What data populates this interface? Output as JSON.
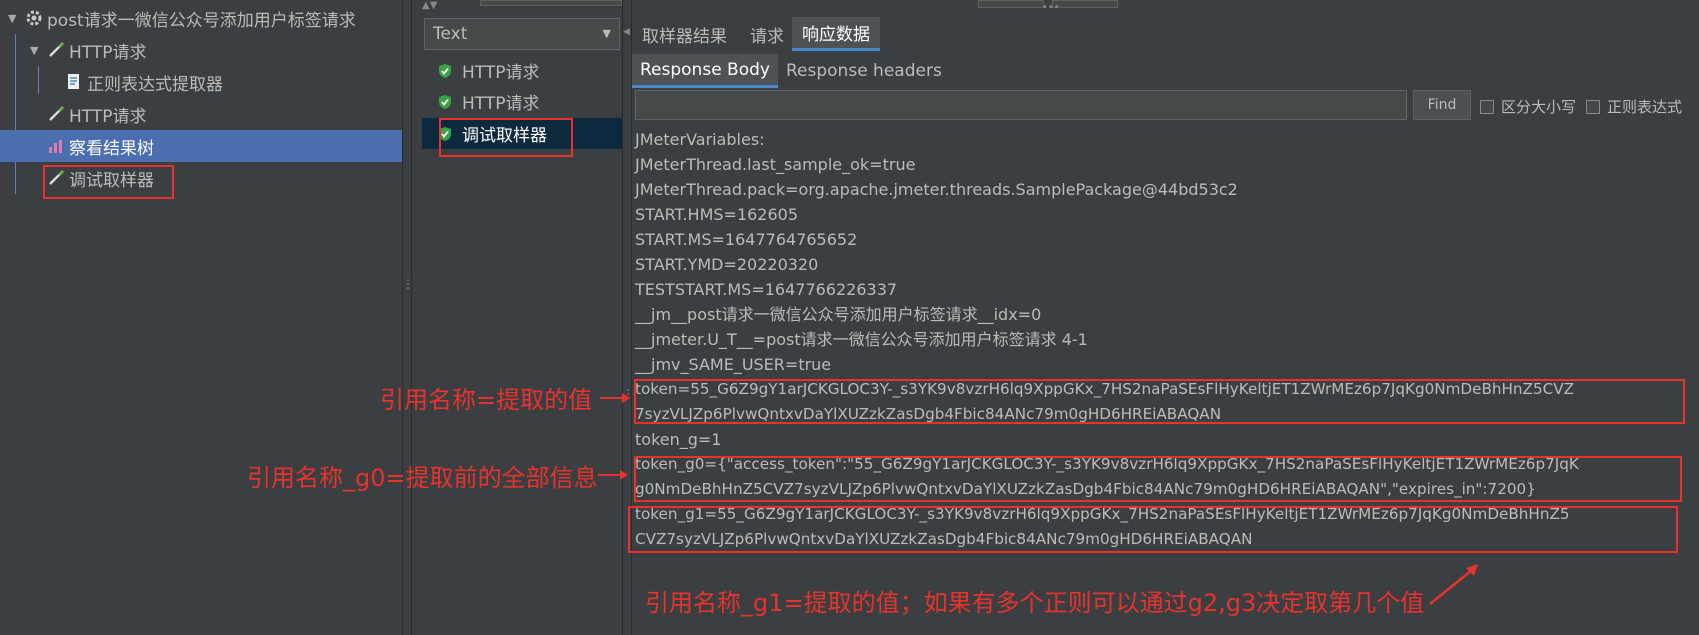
{
  "tree": {
    "root": "post请求一微信公众号添加用户标签请求",
    "items": [
      {
        "label": "HTTP请求"
      },
      {
        "label": "正则表达式提取器"
      },
      {
        "label": "HTTP请求"
      },
      {
        "label": "察看结果树"
      },
      {
        "label": "调试取样器"
      }
    ]
  },
  "results": {
    "renderer": "Text",
    "items": [
      {
        "label": "HTTP请求"
      },
      {
        "label": "HTTP请求"
      },
      {
        "label": "调试取样器"
      }
    ]
  },
  "tabs": {
    "main": [
      "取样器结果",
      "请求",
      "响应数据"
    ],
    "sub": [
      "Response Body",
      "Response headers"
    ]
  },
  "search": {
    "value": "",
    "find_label": "Find",
    "case_label": "区分大小写",
    "regex_label": "正则表达式"
  },
  "body_lines": [
    "JMeterVariables:",
    "JMeterThread.last_sample_ok=true",
    "JMeterThread.pack=org.apache.jmeter.threads.SamplePackage@44bd53c2",
    "START.HMS=162605",
    "START.MS=1647764765652",
    "START.YMD=20220320",
    "TESTSTART.MS=1647766226337",
    "__jm__post请求一微信公众号添加用户标签请求__idx=0",
    "__jmeter.U_T__=post请求一微信公众号添加用户标签请求 4-1",
    "__jmv_SAME_USER=true",
    "token=55_G6Z9gY1arJCKGLOC3Y-_s3YK9v8vzrH6lq9XppGKx_7HS2naPaSEsFlHyKeltjET1ZWrMEz6p7JqKg0NmDeBhHnZ5CVZ",
    "7syzVLJZp6PlvwQntxvDaYlXUZzkZasDgb4Fbic84ANc79m0gHD6HREiABAQAN",
    "token_g=1",
    "token_g0={\"access_token\":\"55_G6Z9gY1arJCKGLOC3Y-_s3YK9v8vzrH6lq9XppGKx_7HS2naPaSEsFlHyKeltjET1ZWrMEz6p7JqK",
    "g0NmDeBhHnZ5CVZ7syzVLJZp6PlvwQntxvDaYlXUZzkZasDgb4Fbic84ANc79m0gHD6HREiABAQAN\",\"expires_in\":7200}",
    "token_g1=55_G6Z9gY1arJCKGLOC3Y-_s3YK9v8vzrH6lq9XppGKx_7HS2naPaSEsFlHyKeltjET1ZWrMEz6p7JqKg0NmDeBhHnZ5",
    "CVZ7syzVLJZp6PlvwQntxvDaYlXUZzkZasDgb4Fbic84ANc79m0gHD6HREiABAQAN"
  ],
  "annotations": {
    "token": "引用名称=提取的值",
    "g0": "引用名称_g0=提取前的全部信息",
    "g1": "引用名称_g1=提取的值；如果有多个正则可以通过g2,g3决定取第几个值"
  },
  "colors": {
    "annotation": "#e8322d",
    "selection": "#4b6eaf",
    "background": "#3c3f41"
  }
}
